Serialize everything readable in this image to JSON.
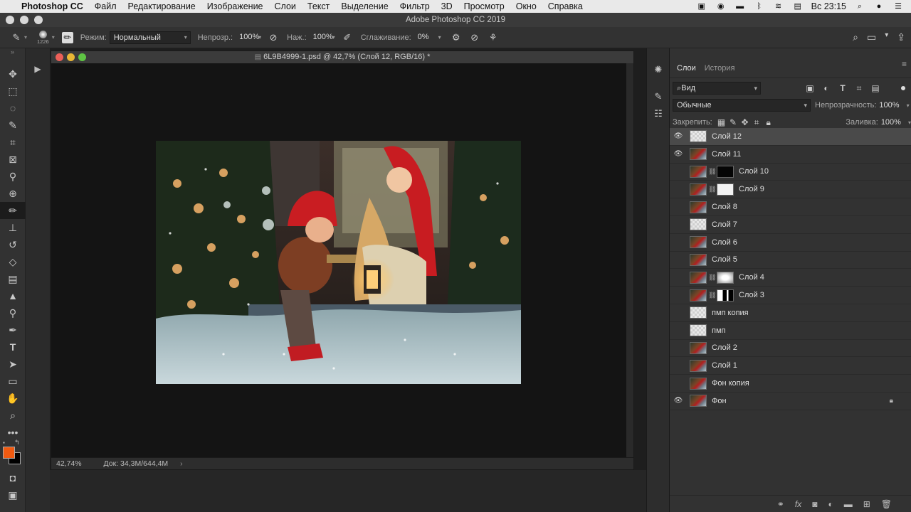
{
  "menubar": {
    "apple": "",
    "app": "Photoshop CC",
    "items": [
      "Файл",
      "Редактирование",
      "Изображение",
      "Слои",
      "Текст",
      "Выделение",
      "Фильтр",
      "3D",
      "Просмотр",
      "Окно",
      "Справка"
    ],
    "lang": "Вс",
    "clock": "23:15"
  },
  "window": {
    "title": "Adobe Photoshop CC 2019"
  },
  "options": {
    "brush_size": "1226",
    "mode_label": "Режим:",
    "mode_value": "Нормальный",
    "opacity_label": "Непрозр.:",
    "opacity_value": "100%",
    "pressure_label": "Наж.:",
    "pressure_value": "100%",
    "smoothing_label": "Сглаживание:",
    "smoothing_value": "0%"
  },
  "document": {
    "title": "6L9B4999-1.psd @ 42,7% (Слой 12, RGB/16) *",
    "zoom": "42,74%",
    "doc_info": "Док: 34,3M/644,4M"
  },
  "colors": {
    "foreground": "#ef5a11",
    "background": "#000000"
  },
  "panel": {
    "tabs": [
      "Слои",
      "История"
    ],
    "filter_value": "Вид",
    "blend_mode": "Обычные",
    "opacity_label": "Непрозрачность:",
    "opacity_value": "100%",
    "lock_label": "Закрепить:",
    "fill_label": "Заливка:",
    "fill_value": "100%"
  },
  "layers": [
    {
      "name": "Слой 12",
      "visible": true,
      "thumb": "blank",
      "mask": null,
      "selected": true
    },
    {
      "name": "Слой 11",
      "visible": true,
      "thumb": "photo",
      "mask": null
    },
    {
      "name": "Слой 10",
      "visible": false,
      "thumb": "photo",
      "mask": "black"
    },
    {
      "name": "Слой 9",
      "visible": false,
      "thumb": "photo",
      "mask": "white"
    },
    {
      "name": "Слой 8",
      "visible": false,
      "thumb": "photo",
      "mask": null
    },
    {
      "name": "Слой 7",
      "visible": false,
      "thumb": "blank",
      "mask": null
    },
    {
      "name": "Слой 6",
      "visible": false,
      "thumb": "photo",
      "mask": null
    },
    {
      "name": "Слой 5",
      "visible": false,
      "thumb": "photo",
      "mask": null
    },
    {
      "name": "Слой 4",
      "visible": false,
      "thumb": "photo",
      "mask": "blur"
    },
    {
      "name": "Слой 3",
      "visible": false,
      "thumb": "photo",
      "mask": "split"
    },
    {
      "name": "пмп копия",
      "visible": false,
      "thumb": "blank",
      "mask": null
    },
    {
      "name": "пмп",
      "visible": false,
      "thumb": "blank",
      "mask": null
    },
    {
      "name": "Слой 2",
      "visible": false,
      "thumb": "photo",
      "mask": null
    },
    {
      "name": "Слой 1",
      "visible": false,
      "thumb": "photo",
      "mask": null
    },
    {
      "name": "Фон копия",
      "visible": false,
      "thumb": "photo",
      "mask": null
    },
    {
      "name": "Фон",
      "visible": true,
      "thumb": "photo",
      "mask": null,
      "locked": true
    }
  ]
}
